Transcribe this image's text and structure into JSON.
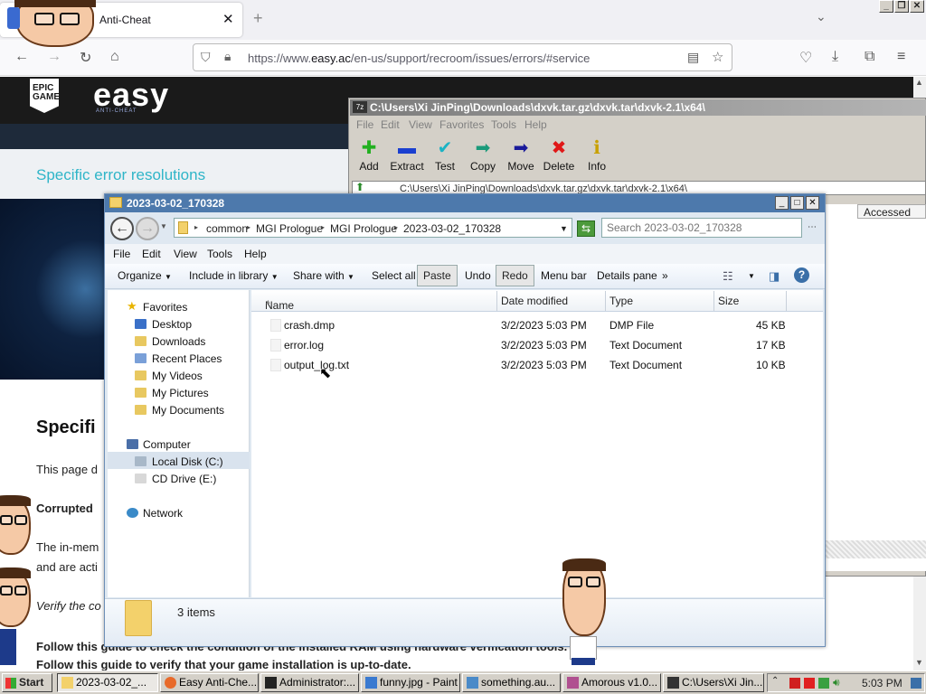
{
  "firefox": {
    "tab_title": "Anti-Cheat",
    "tab_close": "✕",
    "new_tab": "+",
    "tab_list": "⌄",
    "url_prefix": "https://www.",
    "url_domain": "easy.ac",
    "url_rest": "/en-us/support/recroom/issues/errors/#service"
  },
  "window_controls": {
    "minimize": "_",
    "maximize": "❐",
    "close": "✕"
  },
  "page": {
    "epic_logo_text": "EPIC GAMES",
    "easy_logo": "easy",
    "easy_sub": "ANTI-CHEAT",
    "subtitle": "Specific error resolutions",
    "heading": "Specifi",
    "lines": [
      "This page d",
      "Corrupted",
      "The in-mem",
      "and are acti",
      "Verify the co",
      "Follow this guide to check the condition of the installed RAM using hardware verification tools.",
      "Follow this guide to verify that your game installation is up-to-date."
    ]
  },
  "sevenzip": {
    "title": "C:\\Users\\Xi JinPing\\Downloads\\dxvk.tar.gz\\dxvk.tar\\dxvk-2.1\\x64\\",
    "menu": [
      "File",
      "Edit",
      "View",
      "Favorites",
      "Tools",
      "Help"
    ],
    "toolbar": [
      {
        "label": "Add",
        "icon": "plus-icon",
        "glyph": "✚",
        "color": "#22b020"
      },
      {
        "label": "Extract",
        "icon": "minus-icon",
        "glyph": "▬",
        "color": "#1a3fd0"
      },
      {
        "label": "Test",
        "icon": "check-icon",
        "glyph": "✔",
        "color": "#1bb3c4"
      },
      {
        "label": "Copy",
        "icon": "copy-arrow-icon",
        "glyph": "➡",
        "color": "#1a9a7a"
      },
      {
        "label": "Move",
        "icon": "move-arrow-icon",
        "glyph": "➡",
        "color": "#1a1a9a"
      },
      {
        "label": "Delete",
        "icon": "delete-x-icon",
        "glyph": "✖",
        "color": "#e01818"
      },
      {
        "label": "Info",
        "icon": "info-icon",
        "glyph": "ℹ",
        "color": "#c8a000"
      }
    ],
    "address": "C:\\Users\\Xi JinPing\\Downloads\\dxvk.tar.gz\\dxvk.tar\\dxvk-2.1\\x64\\",
    "column_accessed": "Accessed"
  },
  "explorer": {
    "title": "2023-03-02_170328",
    "breadcrumb": [
      "common",
      "MGI Prologue",
      "MGI Prologue",
      "2023-03-02_170328"
    ],
    "search_placeholder": "Search 2023-03-02_170328",
    "menu": [
      "File",
      "Edit",
      "View",
      "Tools",
      "Help"
    ],
    "commands": {
      "organize": "Organize",
      "include": "Include in library",
      "share": "Share with",
      "select_all": "Select all",
      "paste": "Paste",
      "undo": "Undo",
      "redo": "Redo",
      "menu_bar": "Menu bar",
      "details_pane": "Details pane",
      "more": "»"
    },
    "nav": {
      "favorites": "Favorites",
      "desktop": "Desktop",
      "downloads": "Downloads",
      "recent": "Recent Places",
      "videos": "My Videos",
      "pictures": "My Pictures",
      "documents": "My Documents",
      "computer": "Computer",
      "local_disk": "Local Disk (C:)",
      "cd_drive": "CD Drive (E:)",
      "network": "Network"
    },
    "columns": {
      "name": "Name",
      "date": "Date modified",
      "type": "Type",
      "size": "Size"
    },
    "files": [
      {
        "name": "crash.dmp",
        "date": "3/2/2023 5:03 PM",
        "type": "DMP File",
        "size": "45 KB"
      },
      {
        "name": "error.log",
        "date": "3/2/2023 5:03 PM",
        "type": "Text Document",
        "size": "17 KB"
      },
      {
        "name": "output_log.txt",
        "date": "3/2/2023 5:03 PM",
        "type": "Text Document",
        "size": "10 KB"
      }
    ],
    "status": "3 items"
  },
  "taskbar": {
    "start": "Start",
    "tasks": [
      {
        "label": "2023-03-02_...",
        "color": "#f3d16b"
      },
      {
        "label": "Easy Anti-Che...",
        "color": "#e86a2a"
      },
      {
        "label": "Administrator:...",
        "color": "#222222"
      },
      {
        "label": "funny.jpg - Paint",
        "color": "#3a7ad0"
      },
      {
        "label": "something.au...",
        "color": "#4a8ac8"
      },
      {
        "label": "Amorous v1.0...",
        "color": "#b05090"
      },
      {
        "label": "C:\\Users\\Xi Jin...",
        "color": "#333333"
      }
    ],
    "clock": "5:03 PM"
  }
}
